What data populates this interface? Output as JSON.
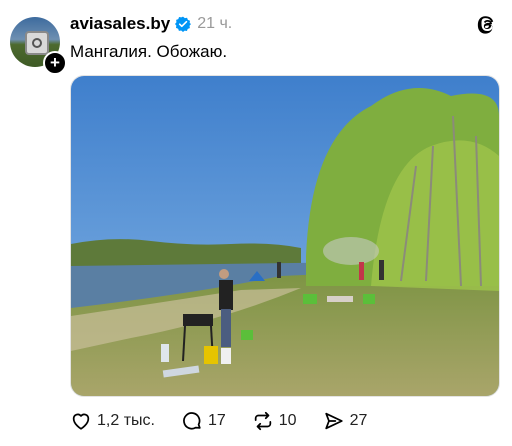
{
  "post": {
    "username": "aviasales.by",
    "time": "21 ч.",
    "caption": "Мангалия. Обожаю."
  },
  "actions": {
    "likes": "1,2 тыс.",
    "comments": "17",
    "reposts": "10",
    "shares": "27"
  },
  "icons": {
    "verified": "verified-badge-icon",
    "threads": "threads-logo-icon",
    "like": "heart-icon",
    "comment": "comment-bubble-icon",
    "repost": "repost-icon",
    "share": "send-icon",
    "follow": "plus-icon"
  },
  "colors": {
    "verified": "#0095f6",
    "meta_text": "#999999"
  }
}
